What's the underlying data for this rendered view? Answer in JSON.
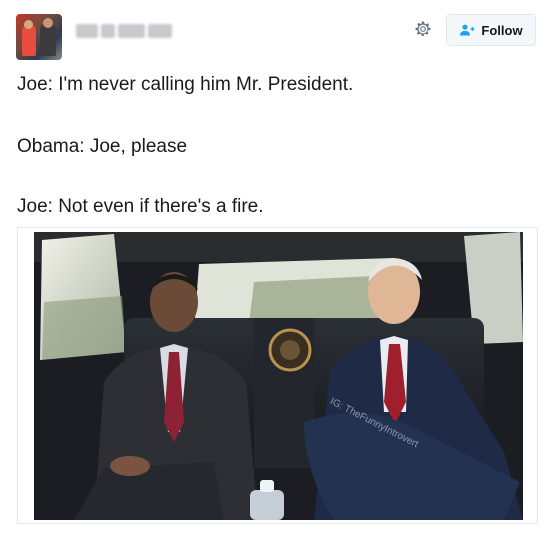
{
  "tweet": {
    "follow_label": "Follow",
    "lines": [
      "Joe: I'm never calling him Mr. President.",
      "Obama: Joe, please",
      "Joe: Not even if there's a fire."
    ]
  },
  "photo": {
    "watermark": "IG: TheFunnyIntrovert"
  },
  "icons": {
    "settings": "gear-icon",
    "follow": "add-user-icon"
  },
  "colors": {
    "follow_bg": "#f5f8fa",
    "follow_border": "#e1e8ed",
    "follow_icon": "#1da1f2"
  }
}
